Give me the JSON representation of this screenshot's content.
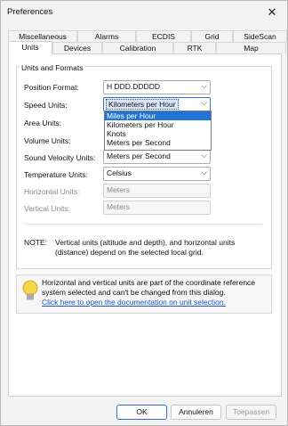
{
  "window": {
    "title": "Preferences",
    "close": "✕"
  },
  "tabs_back": [
    "Miscellaneous",
    "Alarms",
    "ECDIS",
    "Grid",
    "SideScan"
  ],
  "tabs_front": [
    "Units",
    "Devices",
    "Calibration",
    "RTK",
    "Map"
  ],
  "active_tab": "Units",
  "group_title": "Units and Formats",
  "fields": {
    "position_format": {
      "label": "Position Format:",
      "value": "H DDD.DDDDD"
    },
    "speed_units": {
      "label": "Speed Units:",
      "value": "Kilometers per Hour"
    },
    "area_units": {
      "label": "Area Units:"
    },
    "volume_units": {
      "label": "Volume Units:"
    },
    "sound_velocity_units": {
      "label": "Sound Velocity Units:",
      "value": "Meters per Second"
    },
    "temperature_units": {
      "label": "Temperature Units:",
      "value": "Celsius"
    },
    "horizontal_units": {
      "label": "Horizontal Units:",
      "value": "Meters"
    },
    "vertical_units": {
      "label": "Vertical Units:",
      "value": "Meters"
    }
  },
  "speed_options": [
    "Miles per Hour",
    "Kilometers per Hour",
    "Knots",
    "Meters per Second"
  ],
  "speed_highlighted": "Miles per Hour",
  "note": {
    "label": "NOTE:",
    "text": "Vertical units (altitude and depth), and horizontal units (distance) depend on the selected local grid."
  },
  "info": {
    "text": "Horizontal and vertical units are part of the coordinate reference system selected and can't be changed from this dialog.",
    "link": "Click here to open the documentation on unit selection."
  },
  "buttons": {
    "ok": "OK",
    "cancel": "Annuleren",
    "apply": "Toepassen"
  }
}
